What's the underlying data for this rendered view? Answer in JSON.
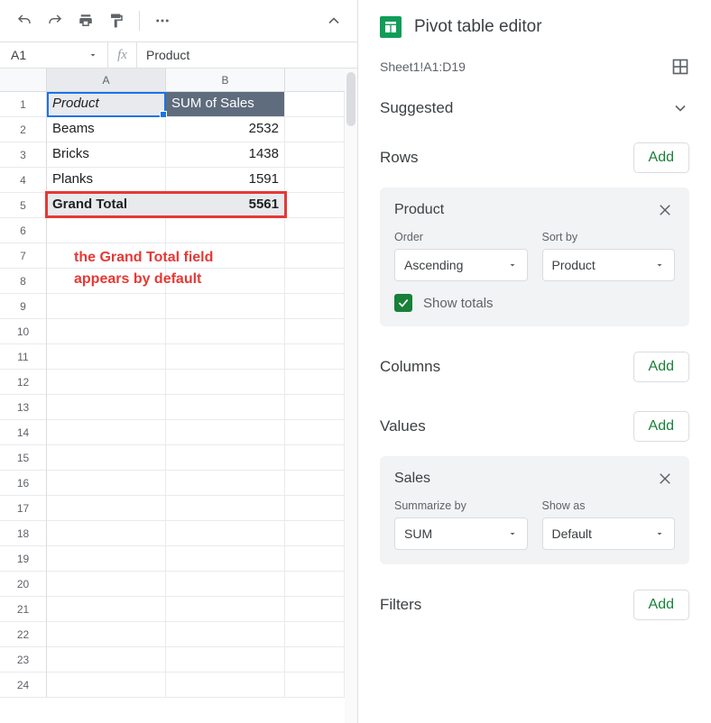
{
  "toolbar": {},
  "namebar": {
    "cell_ref": "A1",
    "fx": "fx",
    "formula": "Product"
  },
  "columns": [
    "A",
    "B"
  ],
  "row_numbers": [
    1,
    2,
    3,
    4,
    5,
    6,
    7,
    8,
    9,
    10,
    11,
    12,
    13,
    14,
    15,
    16,
    17,
    18,
    19,
    20,
    21,
    22,
    23,
    24
  ],
  "sheet": {
    "headers": {
      "A": "Product",
      "B": "SUM of Sales"
    },
    "rows": [
      {
        "A": "Beams",
        "B": "2532"
      },
      {
        "A": "Bricks",
        "B": "1438"
      },
      {
        "A": "Planks",
        "B": "1591"
      }
    ],
    "grand": {
      "A": "Grand Total",
      "B": "5561"
    }
  },
  "annotation": {
    "line1": "the Grand Total field",
    "line2": "appears by default"
  },
  "panel": {
    "title": "Pivot table editor",
    "range": "Sheet1!A1:D19",
    "suggested": "Suggested",
    "rows_label": "Rows",
    "columns_label": "Columns",
    "values_label": "Values",
    "filters_label": "Filters",
    "add_label": "Add",
    "row_card": {
      "title": "Product",
      "order_label": "Order",
      "order_value": "Ascending",
      "sortby_label": "Sort by",
      "sortby_value": "Product",
      "show_totals": "Show totals"
    },
    "value_card": {
      "title": "Sales",
      "summarize_label": "Summarize by",
      "summarize_value": "SUM",
      "showas_label": "Show as",
      "showas_value": "Default"
    }
  }
}
